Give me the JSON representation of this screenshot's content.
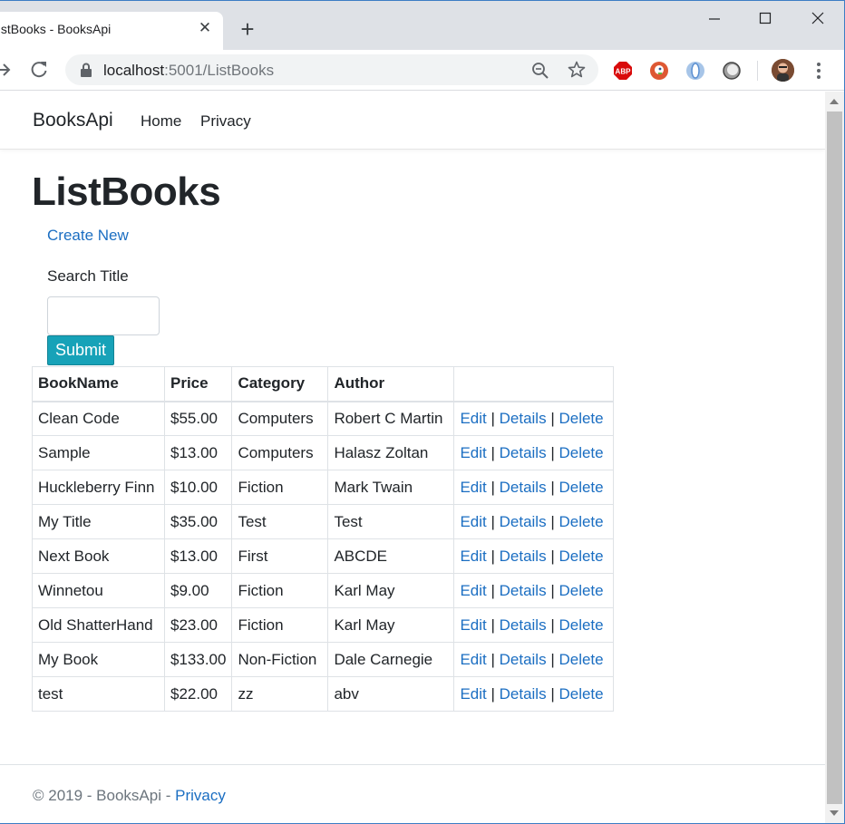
{
  "browser": {
    "tab_title": "ListBooks - BooksApi",
    "address_host": "localhost",
    "address_rest": ":5001/ListBooks",
    "extensions": [
      "adblock-plus-icon",
      "duckduckgo-icon",
      "extension-blue-icon",
      "extension-gray-icon"
    ]
  },
  "navbar": {
    "brand": "BooksApi",
    "links": [
      "Home",
      "Privacy"
    ]
  },
  "main": {
    "title": "ListBooks",
    "create_new": "Create New",
    "search_label": "Search Title",
    "search_value": "",
    "submit_label": "Submit"
  },
  "table": {
    "headers": [
      "BookName",
      "Price",
      "Category",
      "Author",
      ""
    ],
    "action_labels": [
      "Edit",
      "Details",
      "Delete"
    ],
    "rows": [
      {
        "name": "Clean Code",
        "price": "$55.00",
        "category": "Computers",
        "author": "Robert C Martin"
      },
      {
        "name": "Sample",
        "price": "$13.00",
        "category": "Computers",
        "author": "Halasz Zoltan"
      },
      {
        "name": "Huckleberry Finn",
        "price": "$10.00",
        "category": "Fiction",
        "author": "Mark Twain"
      },
      {
        "name": "My Title",
        "price": "$35.00",
        "category": "Test",
        "author": "Test"
      },
      {
        "name": "Next Book",
        "price": "$13.00",
        "category": "First",
        "author": "ABCDE"
      },
      {
        "name": "Winnetou",
        "price": "$9.00",
        "category": "Fiction",
        "author": "Karl May"
      },
      {
        "name": "Old ShatterHand",
        "price": "$23.00",
        "category": "Fiction",
        "author": "Karl May"
      },
      {
        "name": "My Book",
        "price": "$133.00",
        "category": "Non-Fiction",
        "author": "Dale Carnegie"
      },
      {
        "name": "test",
        "price": "$22.00",
        "category": "zz",
        "author": "abv"
      }
    ]
  },
  "footer": {
    "text": "© 2019 - BooksApi - ",
    "privacy_link": "Privacy"
  },
  "colors": {
    "link": "#1b6ec2",
    "submit": "#17a2b8",
    "text": "#212529",
    "muted": "#6c757d"
  }
}
